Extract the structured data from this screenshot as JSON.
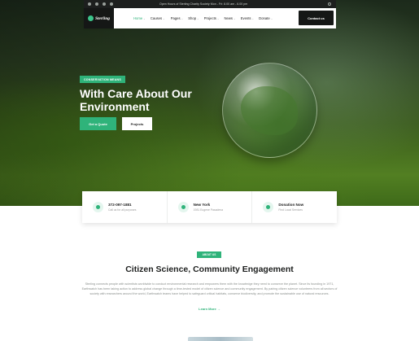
{
  "topbar": {
    "hours": "Open Hours of Sterling Charity Society Mon - Fri: 8.00 am - 6.00 pm",
    "socials": [
      "facebook-icon",
      "twitter-icon",
      "linkedin-icon",
      "instagram-icon"
    ]
  },
  "brand": {
    "name": "Sterling",
    "accent": "#2fb37a",
    "dark": "#151716"
  },
  "nav": {
    "items": [
      {
        "label": "Home"
      },
      {
        "label": "Causes"
      },
      {
        "label": "Pages"
      },
      {
        "label": "Shop"
      },
      {
        "label": "Projects"
      },
      {
        "label": "News"
      },
      {
        "label": "Events"
      },
      {
        "label": "Donate"
      }
    ],
    "chevron": "⌄",
    "contact_label": "Contact us"
  },
  "hero": {
    "badge": "CONSERVATION MEANS",
    "headline": "With Care About Our Environment",
    "primary_button": "Get a Quote",
    "secondary_button": "Projects"
  },
  "info": [
    {
      "title": "372-097-1881",
      "sub": "Call us for all purposes",
      "icon": "phone-icon"
    },
    {
      "title": "New York",
      "sub": "1981 Eugene Pasadena",
      "icon": "location-icon"
    },
    {
      "title": "Donation Now",
      "sub": "Find Local Services",
      "icon": "donation-icon"
    }
  ],
  "about": {
    "badge": "ABOUT US",
    "title": "Citizen Science, Community Engagement",
    "text": "Sterling connects people with scientists worldwide to conduct environmental research and empowers them with the knowledge they need to conserve the planet. Since its founding in 1971, Earthwatch has been taking action to address global change through a time-tested model of citizen science and community engagement. By pairing citizen science volunteers from all sectors of society with researchers around the world, Earthwatch teams have helped to safeguard critical habitats, conserve biodiversity, and promote the sustainable use of natural resources.",
    "learn_more": "Learn More →"
  }
}
